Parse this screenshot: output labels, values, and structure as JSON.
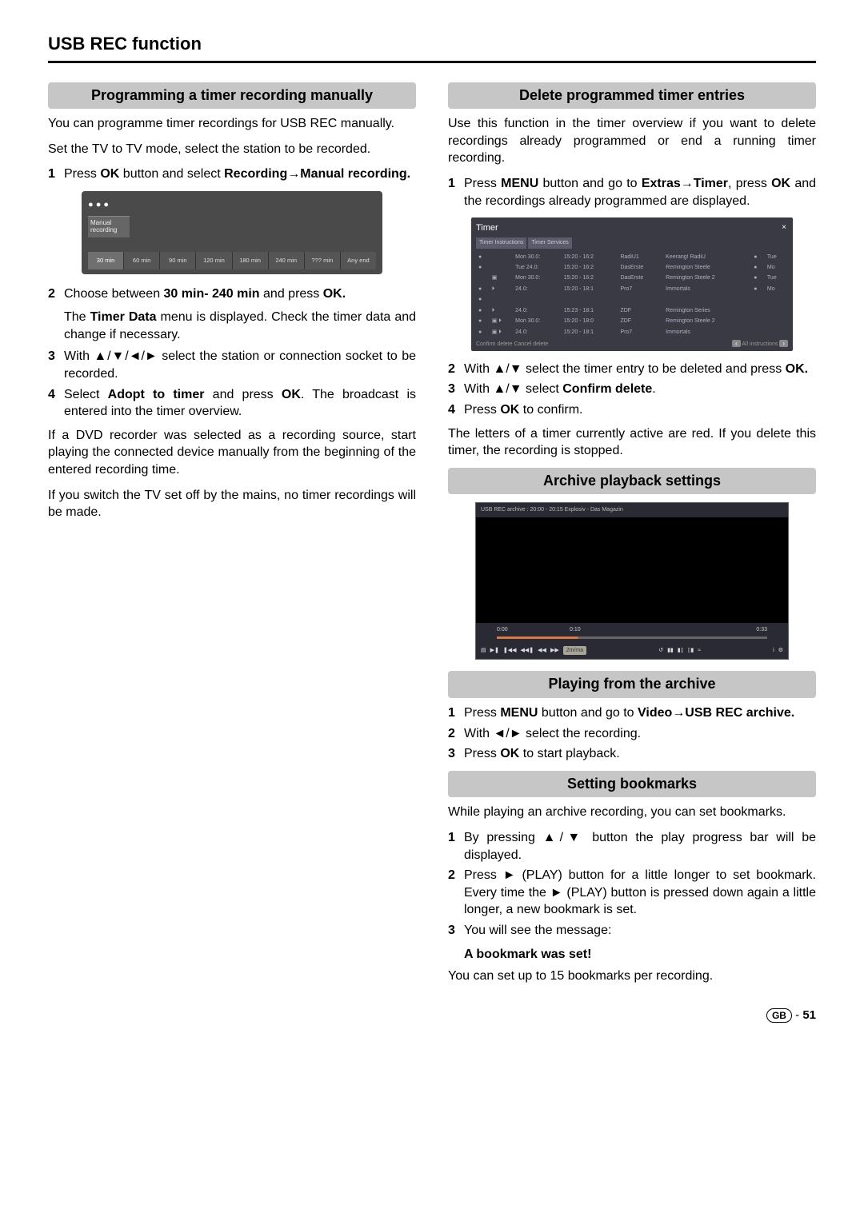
{
  "pageTitle": "USB REC function",
  "left": {
    "h1": "Programming a timer recording manually",
    "p1": "You can programme timer recordings for USB REC manually.",
    "p2": "Set the TV to TV mode, select the station to be recorded.",
    "step1_a": "Press ",
    "step1_b": "OK",
    "step1_c": " button and select ",
    "step1_d": "Recording",
    "step1_e": "→",
    "step1_f": "Manual recording.",
    "fig": {
      "label": "Manual\nrecording",
      "durations": [
        "30 min",
        "60 min",
        "90 min",
        "120 min",
        "180 min",
        "240 min",
        "??? min",
        "Any end"
      ]
    },
    "step2_a": "Choose between ",
    "step2_b": "30 min- 240 min",
    "step2_c": "  and press ",
    "step2_d": "OK.",
    "step2_sub_a": "The ",
    "step2_sub_b": "Timer Data",
    "step2_sub_c": " menu is displayed. Check the timer data and change if necessary.",
    "step3": "With ▲/▼/◄/► select the station or connection socket to be recorded.",
    "step4_a": "Select ",
    "step4_b": "Adopt to timer",
    "step4_c": " and press ",
    "step4_d": "OK",
    "step4_e": ". The broadcast is entered into the timer overview.",
    "p3": "If a DVD recorder was selected as a recording source, start playing the connected device manually from the beginning of the entered recording time.",
    "p4": "If you switch the TV set off by the mains, no timer recordings will be made."
  },
  "right": {
    "h1": "Delete programmed timer entries",
    "p1": "Use this function in the timer overview if you want to delete recordings already programmed or end a running timer recording.",
    "s1_a": "Press ",
    "s1_b": "MENU",
    "s1_c": " button and go to ",
    "s1_d": "Extras",
    "s1_e": "→",
    "s1_f": "Timer",
    "s1_g": ", press ",
    "s1_h": "OK",
    "s1_i": " and the recordings already programmed are displayed.",
    "figTimer": {
      "title": "Timer",
      "tabs": [
        "Timer Instructions",
        "Timer Services"
      ],
      "rows": [
        [
          "●",
          "",
          "Mon 30.0:",
          "15:20 - 16:2",
          "RadiU1",
          "Keerang! RadiU",
          "●",
          "Tue"
        ],
        [
          "●",
          "",
          "Tue 24.0:",
          "15:20 - 16:2",
          "DasErste",
          "Remington Steele",
          "●",
          "Mo"
        ],
        [
          "",
          "▣",
          "Mon 30.0:",
          "15:20 - 16:2",
          "DasErste",
          "Remington Steele 2",
          "●",
          "Tue"
        ],
        [
          "●",
          "⏵",
          "24.0:",
          "15:20 - 18:1",
          "Pro7",
          "Immortals",
          "●",
          "Mo"
        ],
        [
          "●",
          "",
          "",
          "",
          "",
          "",
          "",
          ""
        ],
        [
          "●",
          "⏵",
          "24.0:",
          "15:23 - 18:1",
          "ZDF",
          "Remington Series",
          "",
          ""
        ],
        [
          "●",
          "▣ ⏵",
          "Mon 30.0:",
          "15:20 - 18:0",
          "ZDF",
          "Remington Steele 2",
          "",
          ""
        ],
        [
          "●",
          "▣ ⏵",
          "24.0:",
          "15:20 - 18:1",
          "Pro7",
          "Immortals",
          "",
          ""
        ]
      ],
      "bottomLeft": "Confirm delete    Cancel delete",
      "bottomRight": "All instructions"
    },
    "s2_a": "With ▲/▼ select the timer entry to be deleted and press ",
    "s2_b": "OK.",
    "s3_a": "With ▲/▼ select ",
    "s3_b": "Confirm delete",
    "s3_c": ".",
    "s4_a": "Press ",
    "s4_b": "OK",
    "s4_c": " to confirm.",
    "p2": "The letters of a timer currently active are red. If you delete this timer, the recording is stopped.",
    "h2": "Archive playback settings",
    "figArchive": {
      "top": "USB REC archive :        20:00 - 20:15    Explosiv - Das Magazin",
      "t0": "0:00",
      "t1": "0:10",
      "t2": "0:33",
      "btn": "2m/ma"
    },
    "h3": "Playing from the archive",
    "pa1_a": "Press ",
    "pa1_b": "MENU",
    "pa1_c": " button and go to ",
    "pa1_d": "Video",
    "pa1_e": "→",
    "pa1_f": "USB REC archive.",
    "pa2": "With ◄/► select the recording.",
    "pa3_a": "Press ",
    "pa3_b": "OK",
    "pa3_c": " to start playback.",
    "h4": "Setting bookmarks",
    "sb_p": "While playing an archive recording, you can set bookmarks.",
    "sb1": "By pressing ▲/▼ button the play progress bar will be displayed.",
    "sb2": "Press ► (PLAY) button for a little longer to set bookmark. Every time the ► (PLAY) button is pressed down again a little longer, a new bookmark is set.",
    "sb3": "You will see the message:",
    "sb3b": "A bookmark was set!",
    "sb_p2": "You can set up to 15 bookmarks per recording."
  },
  "footer": {
    "badge": "GB",
    "sep": " - ",
    "page": "51"
  }
}
